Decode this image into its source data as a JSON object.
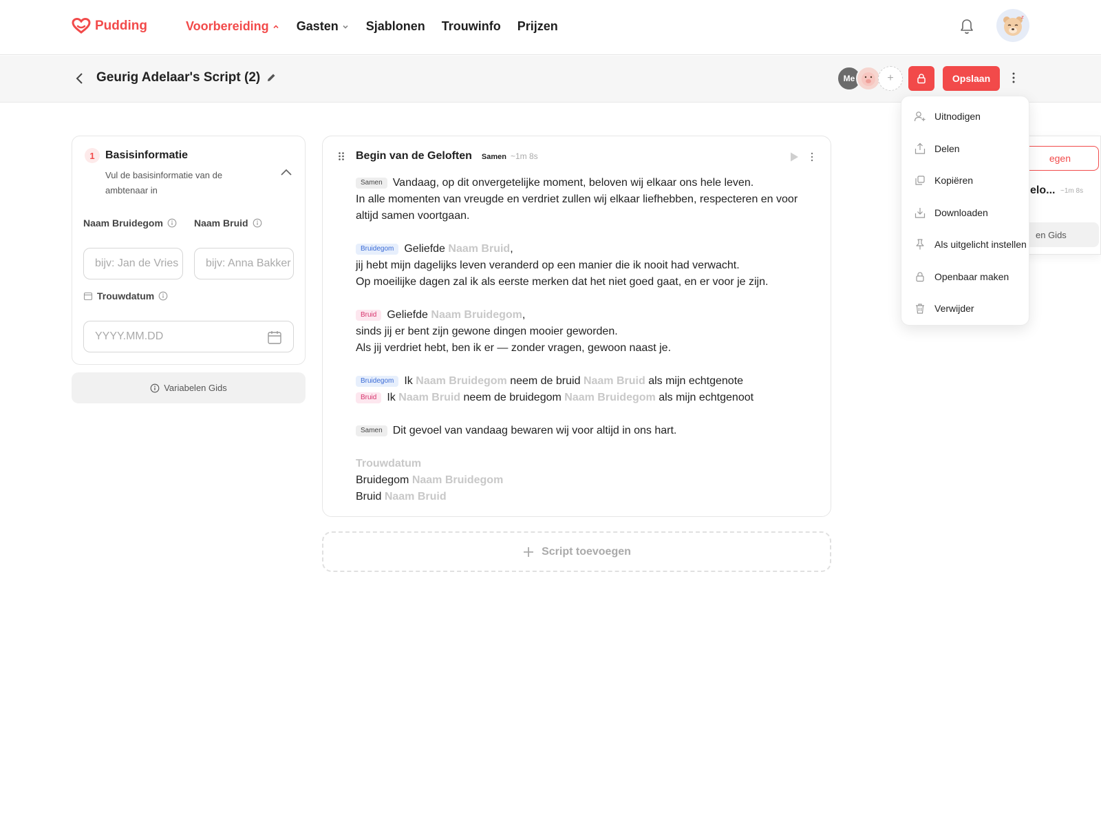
{
  "brand": {
    "name": "Pudding",
    "accent": "#f24a4a"
  },
  "nav": {
    "items": [
      {
        "label": "Voorbereiding",
        "active": true,
        "chevron": "up"
      },
      {
        "label": "Gasten",
        "active": false,
        "chevron": "down"
      },
      {
        "label": "Sjablonen",
        "active": false
      },
      {
        "label": "Trouwinfo",
        "active": false
      },
      {
        "label": "Prijzen",
        "active": false
      }
    ]
  },
  "header": {
    "title": "Geurig Adelaar's Script (2)",
    "collaborators": {
      "me": "Me",
      "add": "+"
    },
    "save_label": "Opslaan"
  },
  "menu": {
    "items": [
      {
        "label": "Uitnodigen",
        "icon": "user-plus-icon"
      },
      {
        "label": "Delen",
        "icon": "share-icon"
      },
      {
        "label": "Kopiëren",
        "icon": "copy-icon"
      },
      {
        "label": "Downloaden",
        "icon": "download-icon"
      },
      {
        "label": "Als uitgelicht instellen",
        "icon": "pin-icon"
      },
      {
        "label": "Openbaar maken",
        "icon": "lock-icon"
      },
      {
        "label": "Verwijder",
        "icon": "trash-icon"
      }
    ]
  },
  "side_panel": {
    "button": "egen",
    "row": "elo...",
    "duration": "~1m 8s",
    "gids": "en Gids"
  },
  "basic": {
    "step": "1",
    "title": "Basisinformatie",
    "description": "Vul de basisinformatie van de ambtenaar in",
    "groom_label": "Naam Bruidegom",
    "bride_label": "Naam Bruid",
    "groom_placeholder": "bijv: Jan de Vries",
    "bride_placeholder": "bijv: Anna Bakker",
    "date_label": "Trouwdatum",
    "date_placeholder": "YYYY.MM.DD",
    "variables_guide": "Variabelen Gids"
  },
  "script": {
    "title": "Begin van de Geloften",
    "tag": "Samen",
    "duration": "~1m 8s",
    "roles": {
      "samen": "Samen",
      "groom": "Bruidegom",
      "bride": "Bruid"
    },
    "vars": {
      "groom": "Naam Bruidegom",
      "bride": "Naam Bruid",
      "date": "Trouwdatum"
    },
    "p1_l1": "Vandaag, op dit onvergetelijke moment, beloven wij elkaar ons hele leven.",
    "p1_l2": "In alle momenten van vreugde en verdriet zullen wij elkaar liefhebben, respecteren en voor altijd samen voortgaan.",
    "p2_pre": "Geliefde",
    "comma": ",",
    "p2_l2": "jij hebt mijn dagelijks leven veranderd op een manier die ik nooit had verwacht.",
    "p2_l3": "Op moeilijke dagen zal ik als eerste merken dat het niet goed gaat, en er voor je zijn.",
    "p3_pre": "Geliefde",
    "p3_l2": "sinds jij er bent zijn gewone dingen mooier geworden.",
    "p3_l3": "Als jij verdriet hebt, ben ik er — zonder vragen, gewoon naast je.",
    "vow_ik": "Ik",
    "vow_groom_mid": "neem de bruid",
    "vow_groom_end": "als mijn echtgenote",
    "vow_bride_mid": "neem de bruidegom",
    "vow_bride_end": "als mijn echtgenoot",
    "p5": "Dit gevoel van vandaag bewaren wij voor altijd in ons hart.",
    "sig_groom": "Bruidegom",
    "sig_bride": "Bruid"
  },
  "add_script_label": "Script toevoegen"
}
